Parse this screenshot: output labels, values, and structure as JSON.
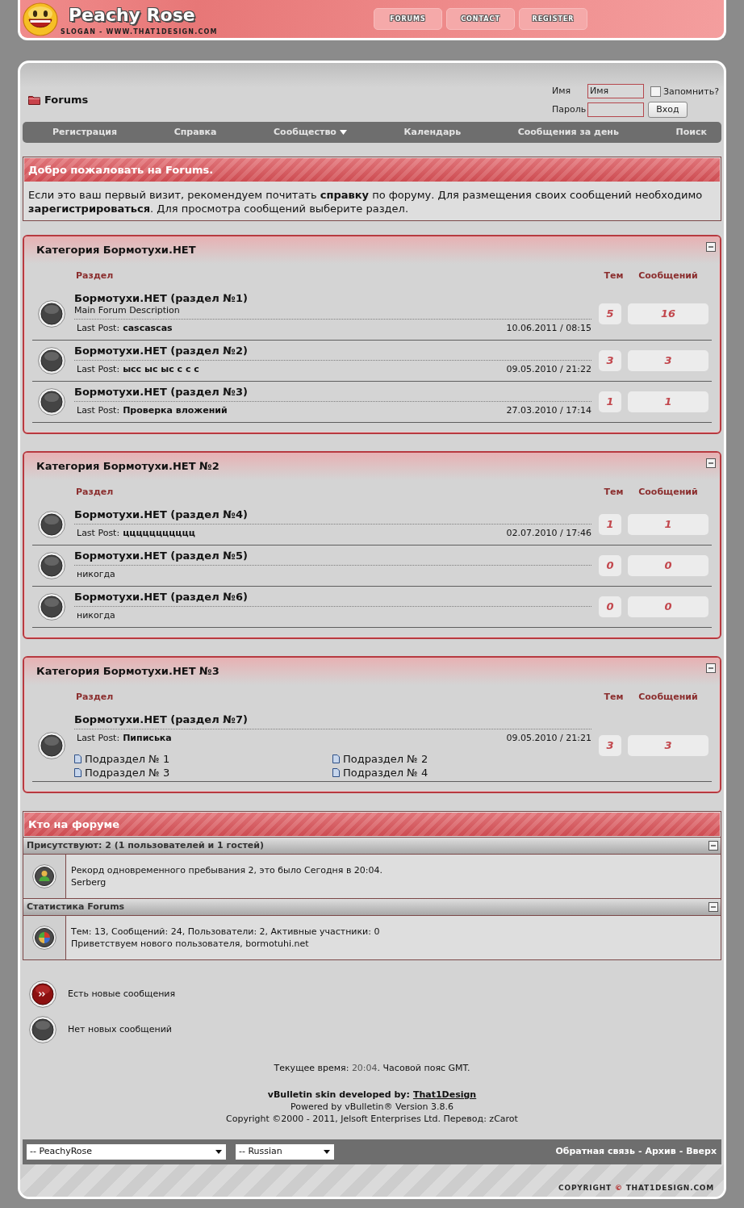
{
  "header": {
    "title": "Peachy Rose",
    "slogan": "SLOGAN - WWW.THAT1DESIGN.COM",
    "nav": [
      "FORUMS",
      "CONTACT",
      "REGISTER"
    ]
  },
  "breadcrumb": "Forums",
  "login": {
    "username_label": "Имя",
    "username_value": "Имя",
    "password_label": "Пароль",
    "remember": {
      "label": "Запомнить?",
      "checked": false
    },
    "submit": "Вход"
  },
  "navbar": [
    {
      "label": "Регистрация",
      "kind": "link"
    },
    {
      "label": "Справка",
      "kind": "link"
    },
    {
      "label": "Сообщество",
      "kind": "menu"
    },
    {
      "label": "Календарь",
      "kind": "link"
    },
    {
      "label": "Сообщения за день",
      "kind": "link"
    },
    {
      "label": "Поиск",
      "kind": "link"
    }
  ],
  "welcome": {
    "title": "Добро пожаловать на Forums.",
    "text": "Если это ваш первый визит, рекомендуем почитать **справку** по форуму. Для размещения своих сообщений необходимо **зарегистрироваться**. Для просмотра сообщений выберите раздел."
  },
  "categories": [
    {
      "title": "Категория Бормотухи.НЕТ",
      "columns": [
        "Раздел",
        "Тем",
        "Сообщений"
      ],
      "forums": [
        {
          "name": "Бормотухи.НЕТ (раздел №1)",
          "description": "Main Forum Description",
          "last_post": {
            "label": "Last Post:",
            "title": "cascascas",
            "date": "10.06.2011 / 08:15"
          },
          "threads": "5",
          "posts": "16",
          "new_posts": false
        },
        {
          "name": "Бормотухи.НЕТ (раздел №2)",
          "last_post": {
            "label": "Last Post:",
            "title": "ысс ыс ыс с с с",
            "date": "09.05.2010 / 21:22"
          },
          "threads": "3",
          "posts": "3",
          "new_posts": false
        },
        {
          "name": "Бормотухи.НЕТ (раздел №3)",
          "last_post": {
            "label": "Last Post:",
            "title": "Проверка вложений",
            "date": "27.03.2010 / 17:14"
          },
          "threads": "1",
          "posts": "1",
          "new_posts": false
        }
      ]
    },
    {
      "title": "Категория Бормотухи.НЕТ №2",
      "columns": [
        "Раздел",
        "Тем",
        "Сообщений"
      ],
      "forums": [
        {
          "name": "Бормотухи.НЕТ (раздел №4)",
          "last_post": {
            "label": "Last Post:",
            "title": "ццццццццццц",
            "date": "02.07.2010 / 17:46"
          },
          "threads": "1",
          "posts": "1",
          "new_posts": false
        },
        {
          "name": "Бормотухи.НЕТ (раздел №5)",
          "last_post_text": "никогда",
          "threads": "0",
          "posts": "0",
          "new_posts": false
        },
        {
          "name": "Бормотухи.НЕТ (раздел №6)",
          "last_post_text": "никогда",
          "threads": "0",
          "posts": "0",
          "new_posts": false
        }
      ]
    },
    {
      "title": "Категория Бормотухи.НЕТ №3",
      "columns": [
        "Раздел",
        "Тем",
        "Сообщений"
      ],
      "forums": [
        {
          "name": "Бормотухи.НЕТ (раздел №7)",
          "last_post": {
            "label": "Last Post:",
            "title": "Пиписька",
            "date": "09.05.2010 / 21:21"
          },
          "threads": "3",
          "posts": "3",
          "new_posts": false,
          "subforums": [
            "Подраздел № 1",
            "Подраздел № 2",
            "Подраздел № 3",
            "Подраздел № 4"
          ]
        }
      ]
    }
  ],
  "whos_online": {
    "title": "Кто на форуме",
    "sections": [
      {
        "title": "Присутствуют: 2 (1 пользователей и 1 гостей)",
        "kind": "users",
        "lines": [
          "Рекорд одновременного пребывания 2, это было Сегодня в 20:04.",
          "Serberg"
        ]
      },
      {
        "title": "Статистика Forums",
        "kind": "stats",
        "lines": [
          "Тем: 13, Сообщений: 24, Пользователи: 2, Активные участники: 0",
          "Приветствуем нового пользователя, bormotuhi.net"
        ]
      }
    ]
  },
  "legend": [
    {
      "label": "Есть новые сообщения",
      "new_posts": true
    },
    {
      "label": "Нет новых сообщений",
      "new_posts": false
    }
  ],
  "footer": {
    "time": {
      "label": "Текущее время:",
      "value": "20:04",
      "suffix": ". Часовой пояс GMT."
    },
    "credit": {
      "text": "vBulletin skin developed by:",
      "link": "That1Design"
    },
    "powered_by": "Powered by vBulletin® Version 3.8.6",
    "copyright": "Copyright ©2000 - 2011, Jelsoft Enterprises Ltd. Перевод: zCarot"
  },
  "bottom_bar": {
    "style_select": "-- PeachyRose",
    "language_select": "-- Russian",
    "links": [
      "Обратная связь",
      "Архив",
      "Вверх"
    ],
    "separator": "-"
  },
  "copyright_mark": [
    "COPYRIGHT",
    "©",
    "THAT1DESIGN.COM"
  ]
}
